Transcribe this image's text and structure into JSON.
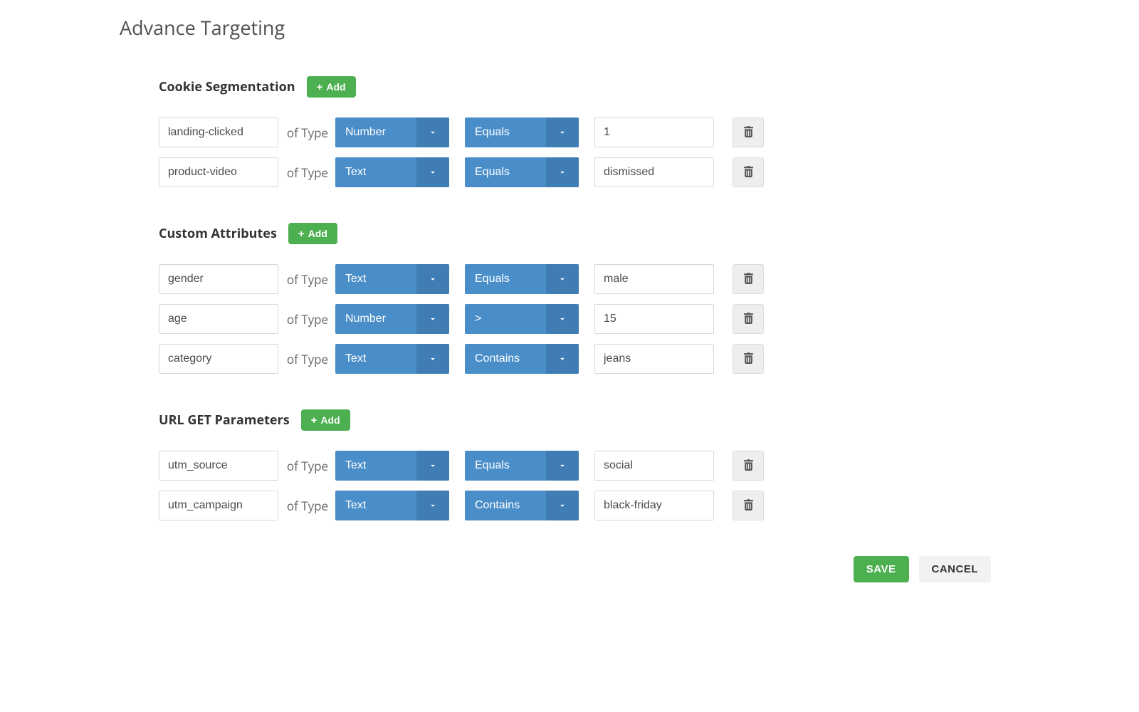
{
  "page_title": "Advance Targeting",
  "labels": {
    "of_type": "of Type",
    "add": "Add"
  },
  "sections": [
    {
      "id": "cookie-segmentation",
      "title": "Cookie Segmentation",
      "rules": [
        {
          "key": "landing-clicked",
          "type": "Number",
          "operator": "Equals",
          "value": "1"
        },
        {
          "key": "product-video",
          "type": "Text",
          "operator": "Equals",
          "value": "dismissed"
        }
      ]
    },
    {
      "id": "custom-attributes",
      "title": "Custom Attributes",
      "rules": [
        {
          "key": "gender",
          "type": "Text",
          "operator": "Equals",
          "value": "male"
        },
        {
          "key": "age",
          "type": "Number",
          "operator": ">",
          "value": "15"
        },
        {
          "key": "category",
          "type": "Text",
          "operator": "Contains",
          "value": "jeans"
        }
      ]
    },
    {
      "id": "url-get-parameters",
      "title": "URL GET Parameters",
      "rules": [
        {
          "key": "utm_source",
          "type": "Text",
          "operator": "Equals",
          "value": "social"
        },
        {
          "key": "utm_campaign",
          "type": "Text",
          "operator": "Contains",
          "value": "black-friday"
        }
      ]
    }
  ],
  "footer": {
    "save_label": "SAVE",
    "cancel_label": "CANCEL"
  }
}
